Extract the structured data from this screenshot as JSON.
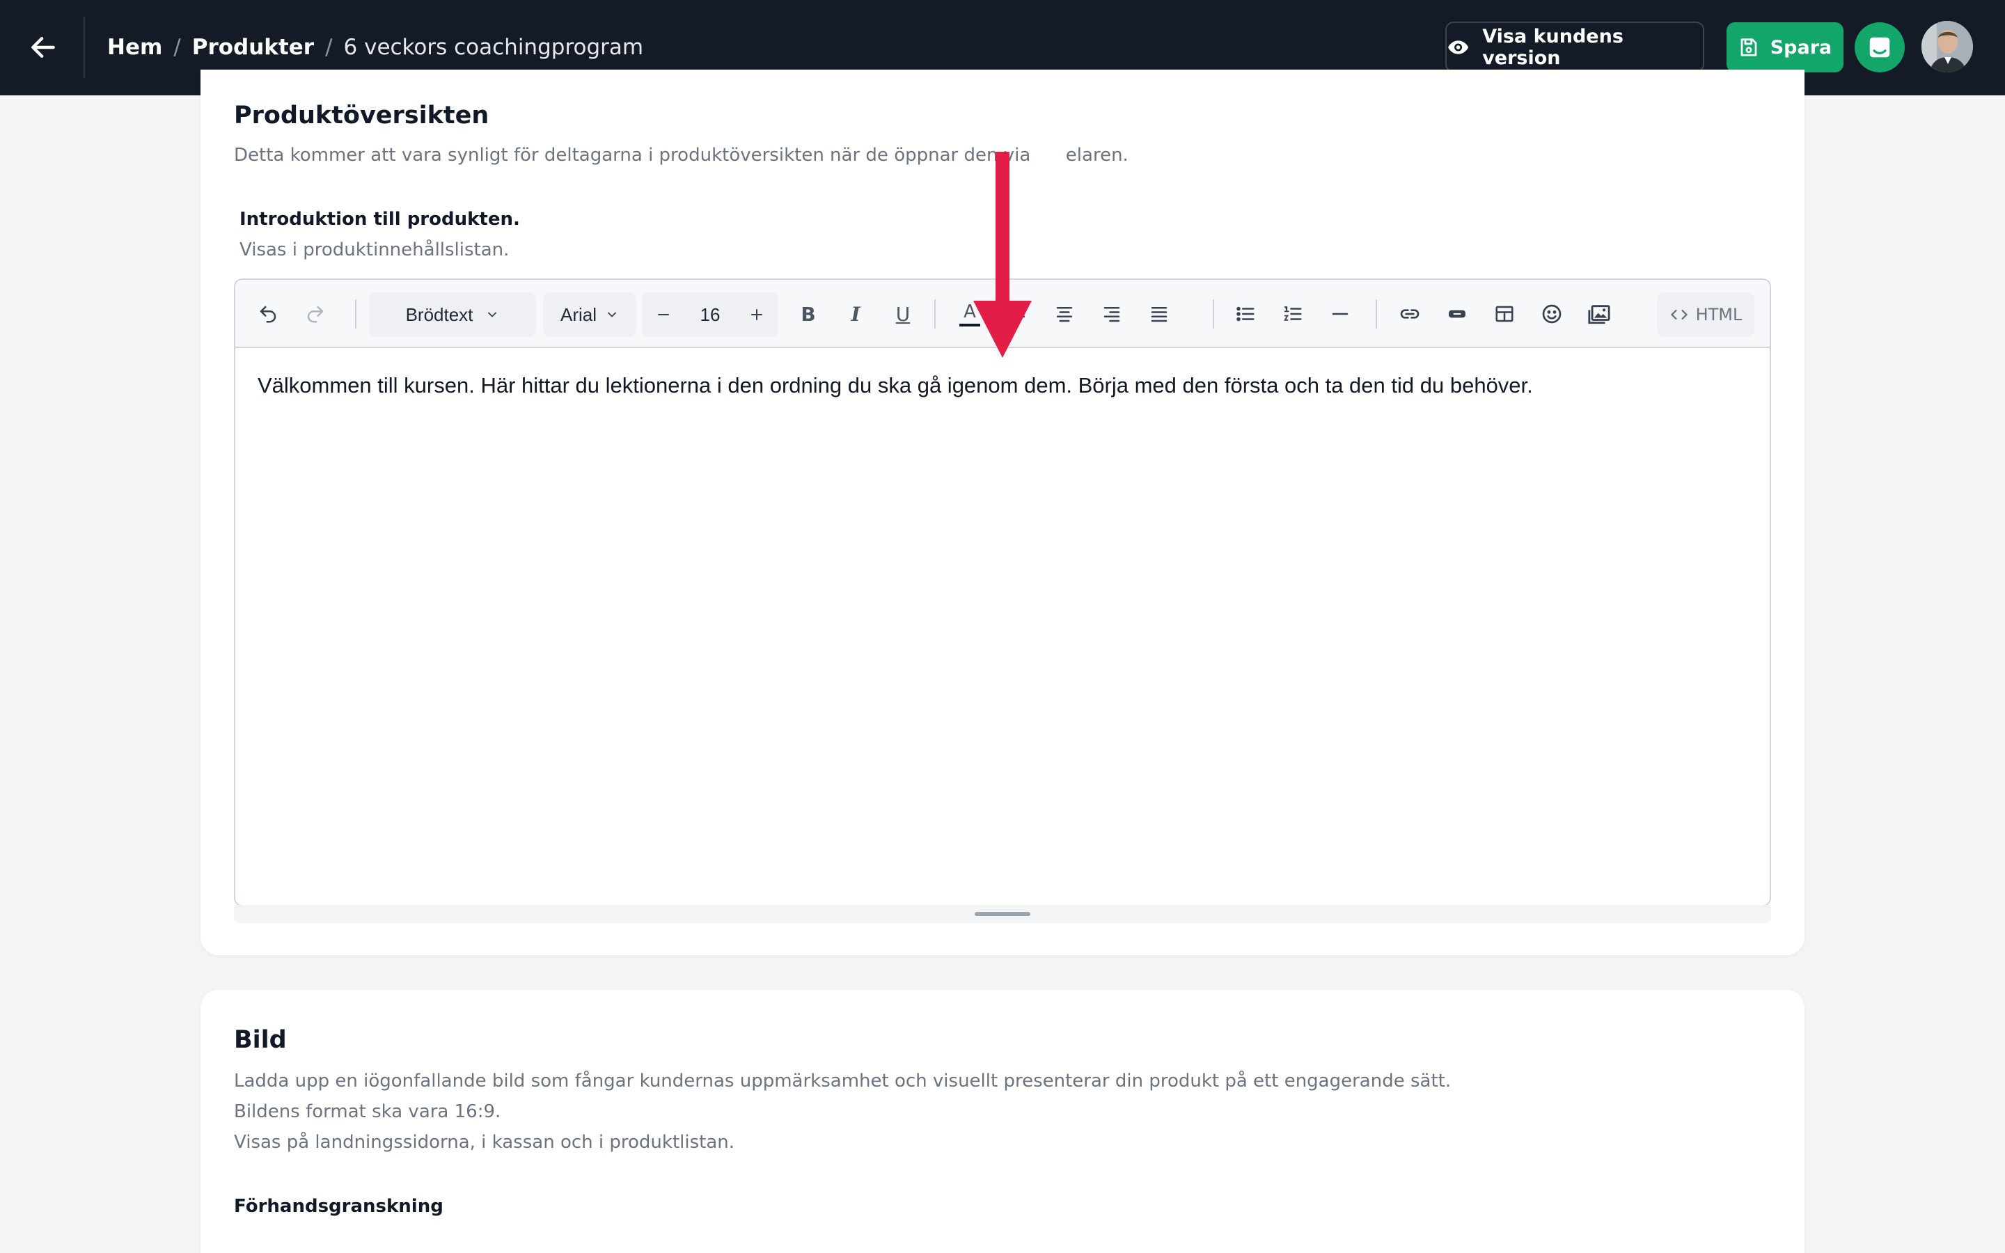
{
  "topbar": {
    "breadcrumb": {
      "home": "Hem",
      "separator": "/",
      "products": "Produkter",
      "current": "6 veckors coachingprogram"
    },
    "preview_label": "Visa kundens version",
    "save_label": "Spara"
  },
  "overview": {
    "title": "Produktöversikten",
    "description": "Detta kommer att vara synligt för deltagarna i produktöversikten när de öppnar den via",
    "description_tail": "elaren.",
    "intro_label": "Introduktion till produkten.",
    "intro_help": "Visas i produktinnehållslistan."
  },
  "editor": {
    "toolbar": {
      "block_style": "Brödtext",
      "font": "Arial",
      "font_size": "16",
      "bold": "B",
      "italic": "I",
      "underline": "U",
      "text_color": "A",
      "html_label": "HTML"
    },
    "content": "Välkommen till kursen. Här hittar du lektionerna i den ordning du ska gå igenom dem. Börja med den första och ta den tid du behöver."
  },
  "image_section": {
    "title": "Bild",
    "desc_1": "Ladda upp en iögonfallande bild som fångar kundernas uppmärksamhet och visuellt presenterar din produkt på ett engagerande sätt.",
    "desc_2": "Bildens format ska vara 16:9.",
    "desc_3": "Visas på landningssidorna, i kassan och i produktlistan.",
    "preview_label": "Förhandsgranskning"
  },
  "colors": {
    "topbar": "#141b27",
    "accent_green": "#13a66a",
    "annotation_arrow": "#e11d48"
  },
  "icons": [
    "arrow-left-icon",
    "eye-icon",
    "save-icon",
    "inbox-icon",
    "undo-icon",
    "redo-icon",
    "chevron-down-icon",
    "minus-icon",
    "plus-icon",
    "bold-icon",
    "italic-icon",
    "underline-icon",
    "text-color-icon",
    "align-left-icon",
    "align-center-icon",
    "align-right-icon",
    "align-justify-icon",
    "bullet-list-icon",
    "numbered-list-icon",
    "horizontal-rule-icon",
    "link-icon",
    "button-icon",
    "table-icon",
    "emoji-icon",
    "image-icon",
    "code-icon"
  ]
}
